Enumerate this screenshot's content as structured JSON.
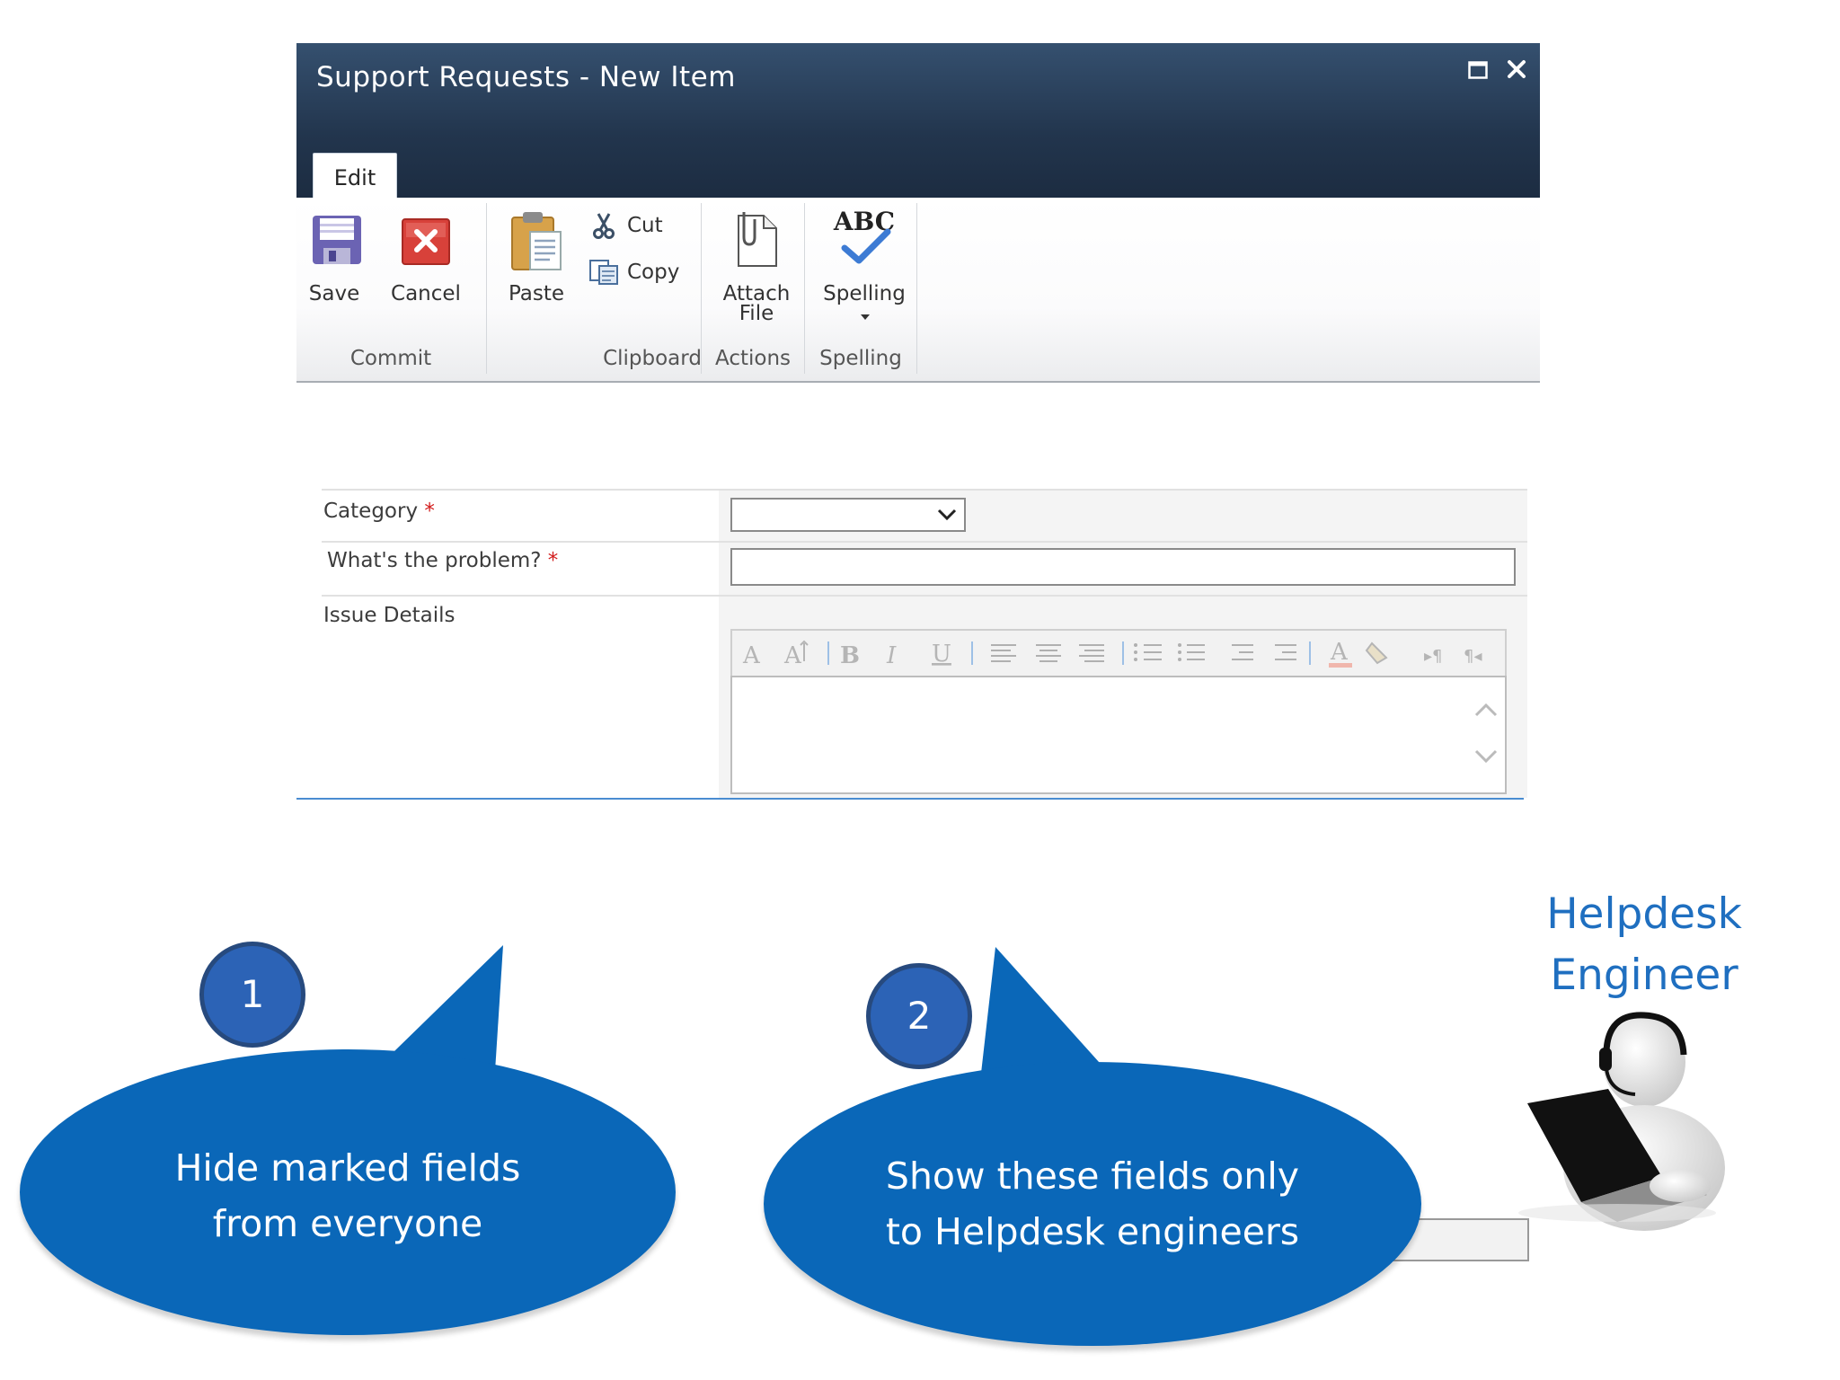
{
  "dialog": {
    "title": "Support Requests - New Item",
    "tab": "Edit"
  },
  "ribbon": {
    "commit": {
      "label": "Commit",
      "save": "Save",
      "cancel": "Cancel"
    },
    "clipboard": {
      "label": "Clipboard",
      "paste": "Paste",
      "cut": "Cut",
      "copy": "Copy"
    },
    "actions": {
      "label": "Actions",
      "attach_line1": "Attach",
      "attach_line2": "File"
    },
    "spelling": {
      "label": "Spelling",
      "button": "Spelling",
      "icon_text": "ABC"
    }
  },
  "form": {
    "category": {
      "label": "Category",
      "required": "*",
      "value": ""
    },
    "problem": {
      "label": "What's the problem?",
      "required": "*",
      "value": ""
    },
    "details": {
      "label": "Issue Details",
      "value": ""
    }
  },
  "callouts": {
    "one": {
      "number": "1",
      "line1": "Hide marked fields",
      "line2": "from everyone"
    },
    "two": {
      "number": "2",
      "line1": "Show these fields only",
      "line2": "to Helpdesk engineers"
    }
  },
  "engineer": {
    "line1": "Helpdesk",
    "line2": "Engineer"
  },
  "colors": {
    "titlebar": "#22354d",
    "bubble": "#0a67b8",
    "number_circle": "#2c63b6",
    "engineer_text": "#1f6fc0",
    "required": "#d21b1b"
  }
}
